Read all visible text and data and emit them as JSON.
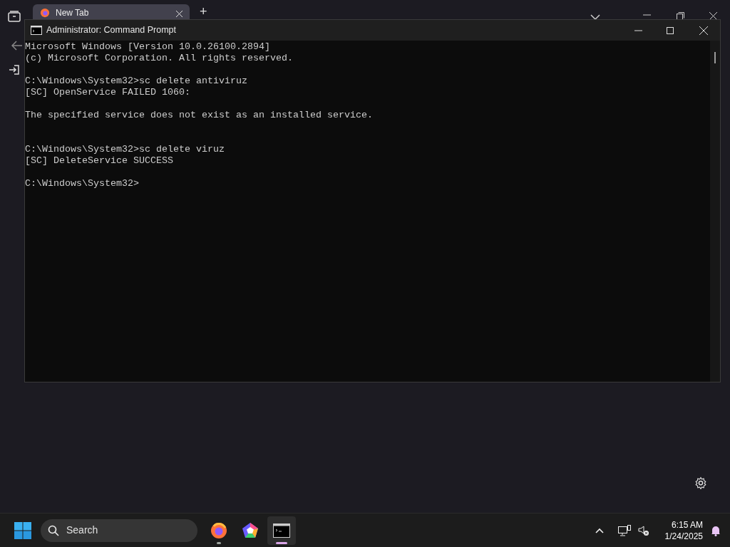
{
  "browser": {
    "tabs": [
      {
        "label": "New Tab",
        "selected": true
      }
    ],
    "new_tab": "+"
  },
  "console_window": {
    "title": "Administrator: Command Prompt",
    "lines": [
      {
        "kind": "text",
        "text": "Microsoft Windows [Version 10.0.26100.2894]"
      },
      {
        "kind": "text",
        "text": "(c) Microsoft Corporation. All rights reserved."
      },
      {
        "kind": "blank"
      },
      {
        "kind": "text",
        "text": "C:\\Windows\\System32>sc delete antiviruz"
      },
      {
        "kind": "text",
        "text": "[SC] OpenService FAILED 1060:"
      },
      {
        "kind": "blank"
      },
      {
        "kind": "text",
        "text": "The specified service does not exist as an installed service."
      },
      {
        "kind": "blank"
      },
      {
        "kind": "blank"
      },
      {
        "kind": "text",
        "text": "C:\\Windows\\System32>sc delete viruz"
      },
      {
        "kind": "text",
        "text": "[SC] DeleteService SUCCESS"
      },
      {
        "kind": "blank"
      },
      {
        "kind": "text",
        "text": "C:\\Windows\\System32>"
      }
    ]
  },
  "taskbar": {
    "search": {
      "placeholder": "Search"
    },
    "apps": [
      {
        "kind": "browser",
        "running": true,
        "selected": false
      },
      {
        "kind": "pentagon",
        "running": false,
        "selected": false
      },
      {
        "kind": "terminal",
        "running": true,
        "selected": true
      }
    ],
    "time": "6:15 AM",
    "date": "1/24/2025"
  }
}
